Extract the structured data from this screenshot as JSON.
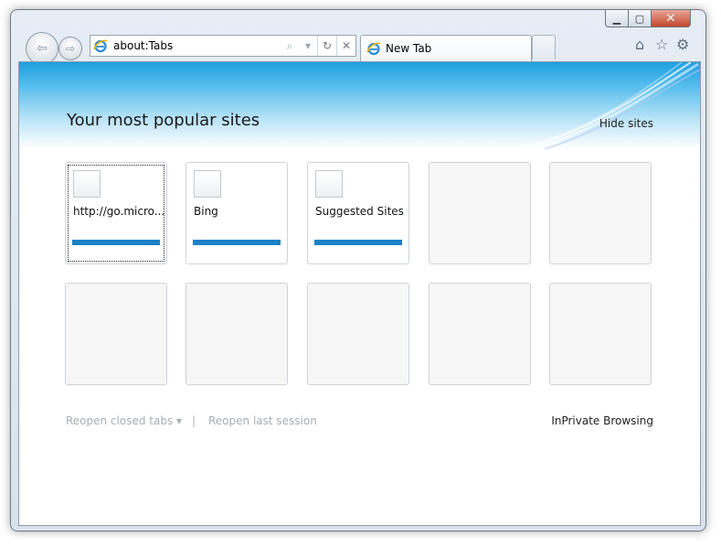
{
  "window": {
    "controls": {
      "minimize": "▁",
      "maximize": "▢",
      "close": "✕"
    }
  },
  "nav": {
    "back_icon": "back-arrow-icon",
    "forward_icon": "forward-arrow-icon"
  },
  "address_bar": {
    "value": "about:Tabs",
    "search_icon": "⌕",
    "dropdown_icon": "▾",
    "refresh_icon": "↻",
    "stop_icon": "✕"
  },
  "tab": {
    "label": "New Tab"
  },
  "command_bar": {
    "home_icon": "⌂",
    "favorites_icon": "☆",
    "tools_icon": "⚙"
  },
  "content": {
    "title": "Your most popular sites",
    "hide_sites": "Hide sites",
    "tiles": [
      {
        "label": "http://go.micro..."
      },
      {
        "label": "Bing"
      },
      {
        "label": "Suggested Sites"
      }
    ],
    "footer": {
      "reopen_closed_tabs": "Reopen closed tabs",
      "reopen_dropdown": "▾",
      "separator": "|",
      "reopen_last_session": "Reopen last session",
      "inprivate": "InPrivate Browsing"
    }
  },
  "colors": {
    "accent": "#1a82c4",
    "banner_top": "#1e9fe0",
    "close_button": "#c4462c"
  }
}
